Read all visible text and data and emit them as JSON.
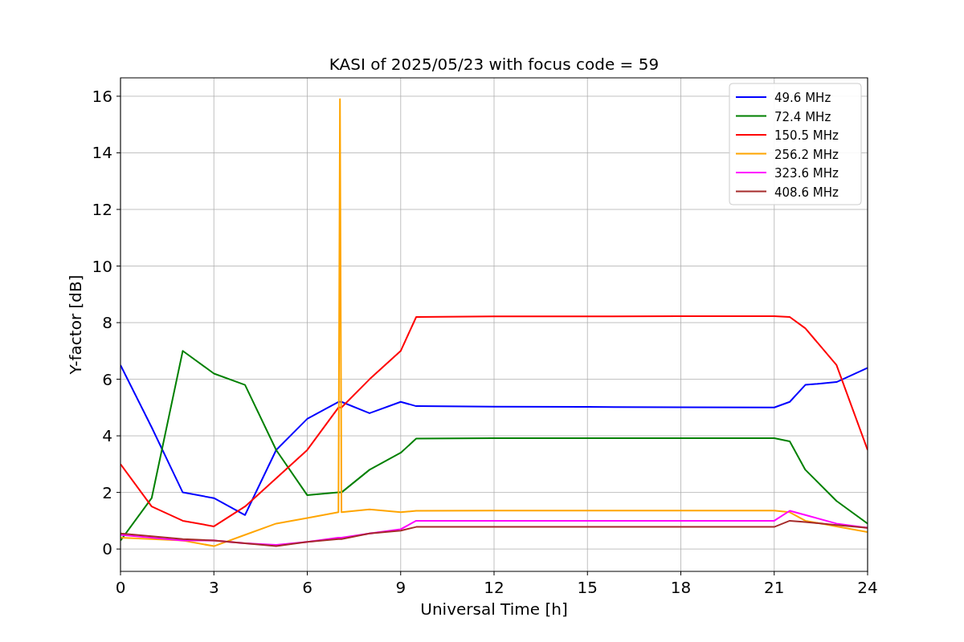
{
  "figure": {
    "chart_data": {
      "type": "line",
      "title": "KASI of 2025/05/23 with focus code = 59",
      "xlabel": "Universal Time [h]",
      "ylabel": "Y-factor [dB]",
      "x": [
        0,
        1,
        2,
        3,
        4,
        5,
        6,
        7,
        7.05,
        7.1,
        8,
        9,
        9.5,
        12,
        15,
        18,
        21,
        21.5,
        22,
        23,
        24
      ],
      "series": [
        {
          "name": "49.6 MHz",
          "color": "#0000ff",
          "values": [
            6.5,
            4.3,
            2.0,
            1.8,
            1.2,
            3.5,
            4.6,
            5.2,
            5.2,
            5.2,
            4.8,
            5.2,
            5.05,
            5.03,
            5.02,
            5.01,
            5.0,
            5.2,
            5.8,
            5.9,
            6.4
          ]
        },
        {
          "name": "72.4 MHz",
          "color": "#008000",
          "values": [
            0.3,
            1.8,
            7.0,
            6.2,
            5.8,
            3.5,
            1.9,
            2.0,
            2.0,
            2.0,
            2.8,
            3.4,
            3.9,
            3.92,
            3.92,
            3.92,
            3.92,
            3.8,
            2.8,
            1.7,
            0.9
          ]
        },
        {
          "name": "150.5 MHz",
          "color": "#ff0000",
          "values": [
            3.0,
            1.5,
            1.0,
            0.8,
            1.5,
            2.5,
            3.5,
            5.0,
            5.0,
            5.0,
            6.0,
            7.0,
            8.2,
            8.22,
            8.22,
            8.23,
            8.23,
            8.2,
            7.8,
            6.5,
            3.5
          ]
        },
        {
          "name": "256.2 MHz",
          "color": "#ffa500",
          "values": [
            0.4,
            0.35,
            0.3,
            0.1,
            0.5,
            0.9,
            1.1,
            1.3,
            15.9,
            1.3,
            1.4,
            1.3,
            1.35,
            1.36,
            1.36,
            1.36,
            1.36,
            1.3,
            1.0,
            0.8,
            0.6
          ]
        },
        {
          "name": "323.6 MHz",
          "color": "#ff00ff",
          "values": [
            0.5,
            0.4,
            0.3,
            0.3,
            0.2,
            0.15,
            0.25,
            0.4,
            0.4,
            0.4,
            0.55,
            0.7,
            1.0,
            1.0,
            1.0,
            1.0,
            1.0,
            1.35,
            1.2,
            0.9,
            0.75
          ]
        },
        {
          "name": "408.6 MHz",
          "color": "#a52a2a",
          "values": [
            0.55,
            0.45,
            0.35,
            0.3,
            0.2,
            0.1,
            0.25,
            0.35,
            0.35,
            0.35,
            0.55,
            0.65,
            0.78,
            0.78,
            0.78,
            0.78,
            0.78,
            1.0,
            0.95,
            0.85,
            0.75
          ]
        }
      ],
      "xlim": [
        0,
        24
      ],
      "ylim": [
        -0.79,
        16.65
      ],
      "xticks": [
        0,
        3,
        6,
        9,
        12,
        15,
        18,
        21,
        24
      ],
      "yticks": [
        0,
        2,
        4,
        6,
        8,
        10,
        12,
        14,
        16
      ],
      "grid": true,
      "legend": "upper right"
    }
  }
}
